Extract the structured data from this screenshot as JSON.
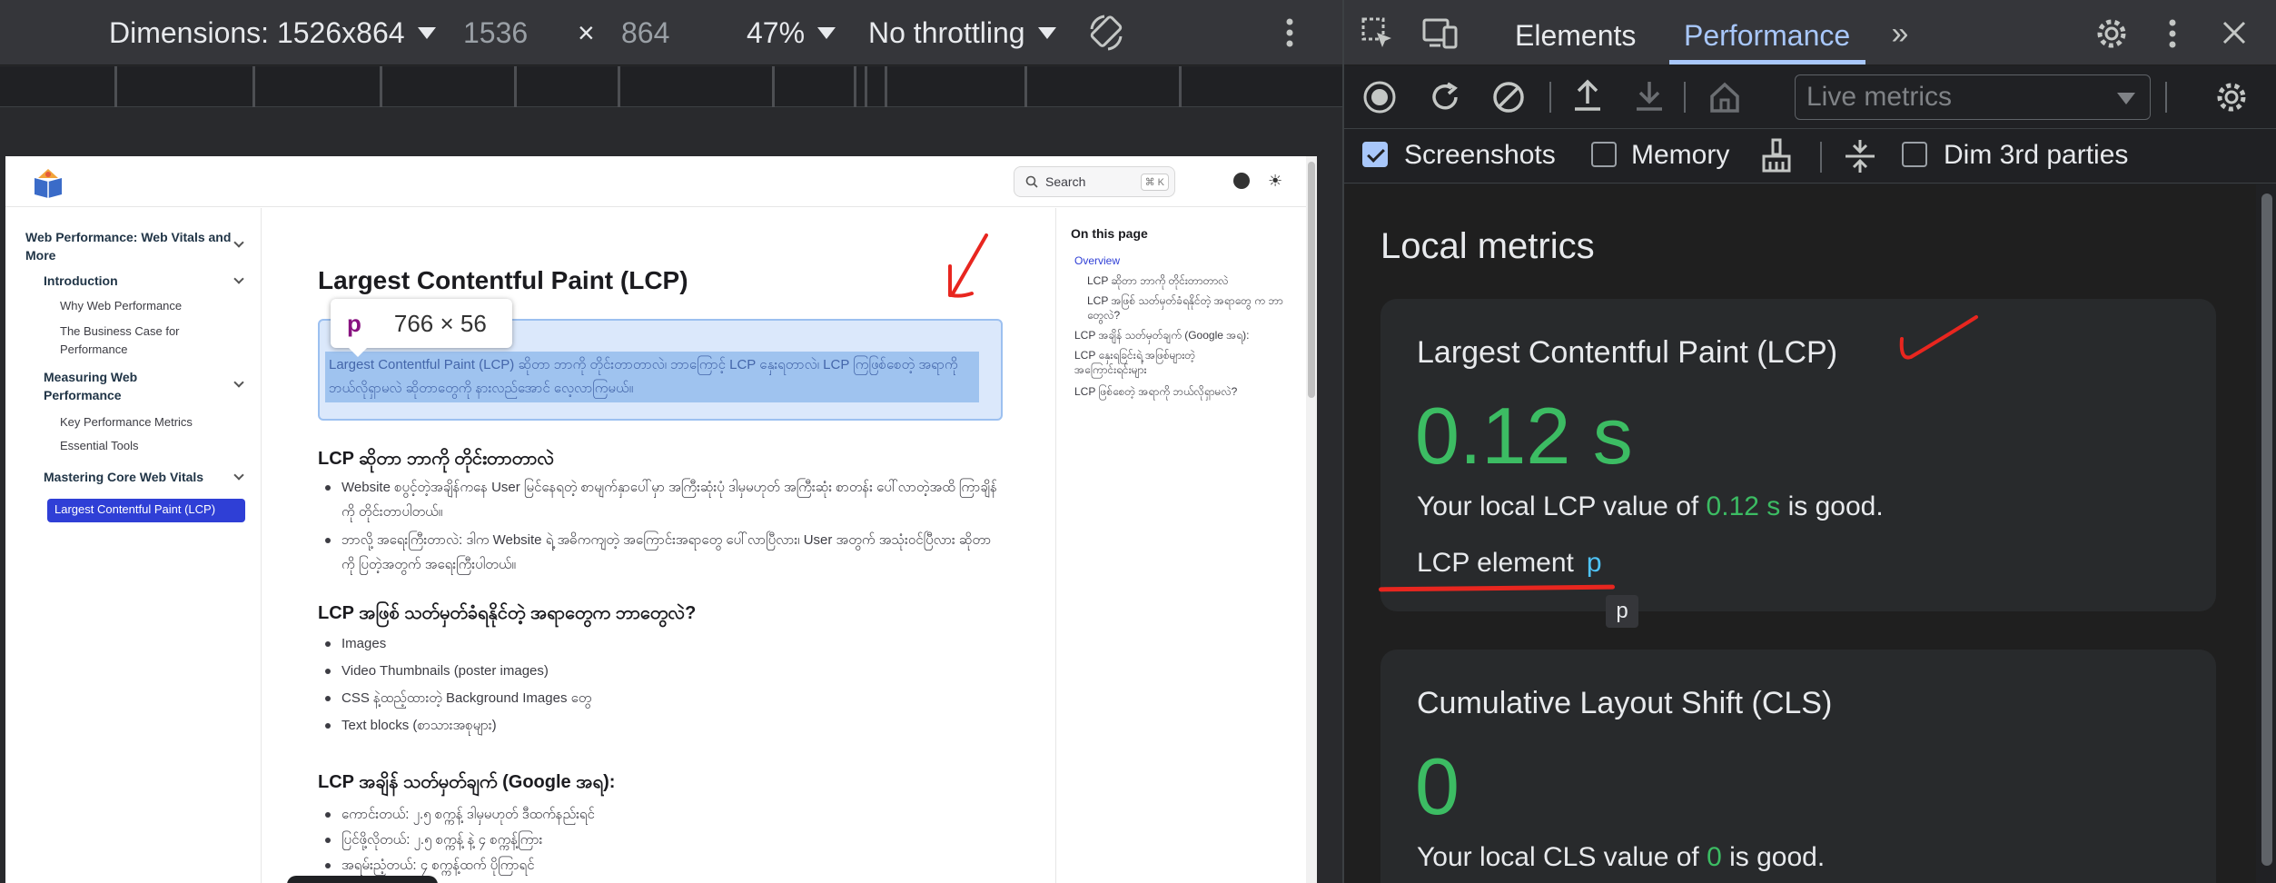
{
  "device_toolbar": {
    "dimensions_label": "Dimensions: 1526x864",
    "width": "1536",
    "times": "×",
    "height": "864",
    "zoom": "47%",
    "throttling": "No throttling"
  },
  "site": {
    "search_label": "Search",
    "search_kbd": "⌘ K",
    "sidebar": [
      {
        "label": "Web Performance: Web Vitals and More",
        "type": "h"
      },
      {
        "label": "Introduction",
        "type": "h"
      },
      {
        "label": "Why Web Performance",
        "type": "s"
      },
      {
        "label": "The Business Case for Performance",
        "type": "s"
      },
      {
        "label": "Measuring Web Performance",
        "type": "h"
      },
      {
        "label": "Key Performance Metrics",
        "type": "s"
      },
      {
        "label": "Essential Tools",
        "type": "s"
      },
      {
        "label": "Mastering Core Web Vitals",
        "type": "h"
      }
    ],
    "sidebar_active": "Largest Contentful Paint (LCP)",
    "title": "Largest Contentful Paint (LCP)",
    "highlight_text": "Largest Contentful Paint (LCP) ဆိုတာ ဘာကို တိုင်းတာတာလဲ၊ ဘာကြောင့် LCP နှေးရတာလဲ၊ LCP ကြဖြစ်စေတဲ့ အရာကို ဘယ်လိုရှာမလဲ ဆိုတာတွေကို နားလည်အောင် လေ့လာကြမယ်။",
    "tooltip": {
      "tag": "p",
      "size": "766 × 56"
    },
    "section1_title": "LCP ဆိုတာ ဘာကို တိုင်းတာတာလဲ",
    "section1_items": [
      "Website စပွင့်တဲ့အချိန်ကနေ User မြင်နေရတဲ့ စာမျက်နှာပေါ်မှာ အကြီးဆုံးပုံ ဒါမှမဟုတ် အကြီးဆုံး စာတန်း ပေါ်လာတဲ့အထိ ကြာချိန်ကို တိုင်းတာပါတယ်။",
      "ဘာလို့ အရေးကြီးတာလဲ: ဒါက Website ရဲ့ အဓိကကျတဲ့ အကြောင်းအရာတွေ ပေါ်လာပြီလား၊ User အတွက် အသုံးဝင်ပြီလား ဆိုတာကို ပြတဲ့အတွက် အရေးကြီးပါတယ်။"
    ],
    "section2_title": "LCP အဖြစ် သတ်မှတ်ခံရနိုင်တဲ့ အရာတွေက ဘာတွေလဲ?",
    "section2_items": [
      "Images",
      "Video Thumbnails (poster images)",
      "CSS နဲ့ထည့်ထားတဲ့ Background Images တွေ",
      "Text blocks (စာသားအစုများ)"
    ],
    "section3_title": "LCP အချိန် သတ်မှတ်ချက် (Google အရ):",
    "section3_items": [
      "ကောင်းတယ်: ၂.၅ စက္ကန့် ဒါမှမဟုတ် ဒီထက်နည်းရင်",
      "ပြင်ဖို့လိုတယ်: ၂.၅ စက္ကန့် နဲ့ ၄ စက္ကန့်ကြား",
      "အရမ်းညံ့တယ်: ၄ စက္ကန့်ထက် ပိုကြာရင်"
    ],
    "toc_title": "On this page",
    "toc": [
      {
        "label": "Overview",
        "active": true,
        "indent": 0
      },
      {
        "label": "LCP ဆိုတာ ဘာကို တိုင်းတာတာလဲ",
        "active": false,
        "indent": 1
      },
      {
        "label": "LCP အဖြစ် သတ်မှတ်ခံရနိုင်တဲ့ အရာတွေ က ဘာတွေလဲ?",
        "active": false,
        "indent": 1
      },
      {
        "label": "LCP အချိန် သတ်မှတ်ချက် (Google အရ):",
        "active": false,
        "indent": 0
      },
      {
        "label": "LCP နှေးရခြင်းရဲ့ အဖြစ်များတဲ့ အကြောင်းရင်းများ",
        "active": false,
        "indent": 0
      },
      {
        "label": "LCP ဖြစ်စေတဲ့ အရာကို ဘယ်လိုရှာမလဲ?",
        "active": false,
        "indent": 0
      }
    ]
  },
  "devtools": {
    "tabs": [
      "Elements",
      "Performance"
    ],
    "active_tab": "Performance",
    "live_metrics": "Live metrics",
    "checkboxes": {
      "screenshots": "Screenshots",
      "memory": "Memory",
      "dim": "Dim 3rd parties"
    },
    "local_metrics_title": "Local metrics",
    "lcp": {
      "title": "Largest Contentful Paint (LCP)",
      "value": "0.12 s",
      "desc_prefix": "Your local LCP value of ",
      "desc_value": "0.12 s",
      "desc_suffix": " is good.",
      "element_label": "LCP element",
      "element_tag": "p",
      "tooltip_tag": "p"
    },
    "cls": {
      "title": "Cumulative Layout Shift (CLS)",
      "value": "0",
      "desc_prefix": "Your local CLS value of ",
      "desc_value": "0",
      "desc_suffix": " is good."
    }
  },
  "colors": {
    "good": "#3cbc63",
    "accent": "#a8c7fa",
    "annotation": "#e8261f"
  }
}
